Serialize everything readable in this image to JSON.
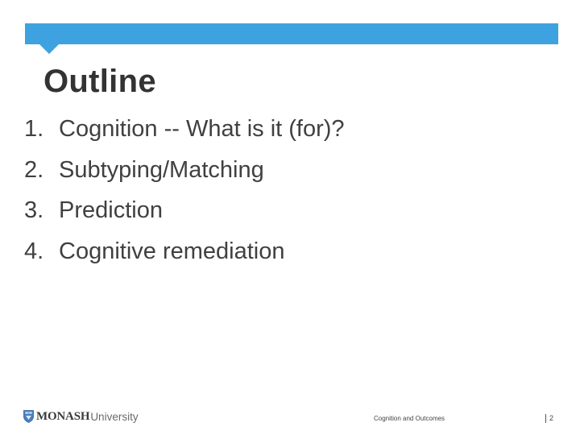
{
  "slide": {
    "title": "Outline",
    "accent_color": "#3EA2E0",
    "items": [
      {
        "number": "1.",
        "label": "Cognition -- What is it (for)?"
      },
      {
        "number": "2.",
        "label": "Subtyping/Matching"
      },
      {
        "number": "3.",
        "label": "Prediction"
      },
      {
        "number": "4.",
        "label": "Cognitive remediation"
      }
    ]
  },
  "footer": {
    "logo": {
      "icon": "monash-shield-icon",
      "name_bold": "MONASH",
      "name_light": "University"
    },
    "caption": "Cognition and Outcomes",
    "page_number": "2"
  }
}
